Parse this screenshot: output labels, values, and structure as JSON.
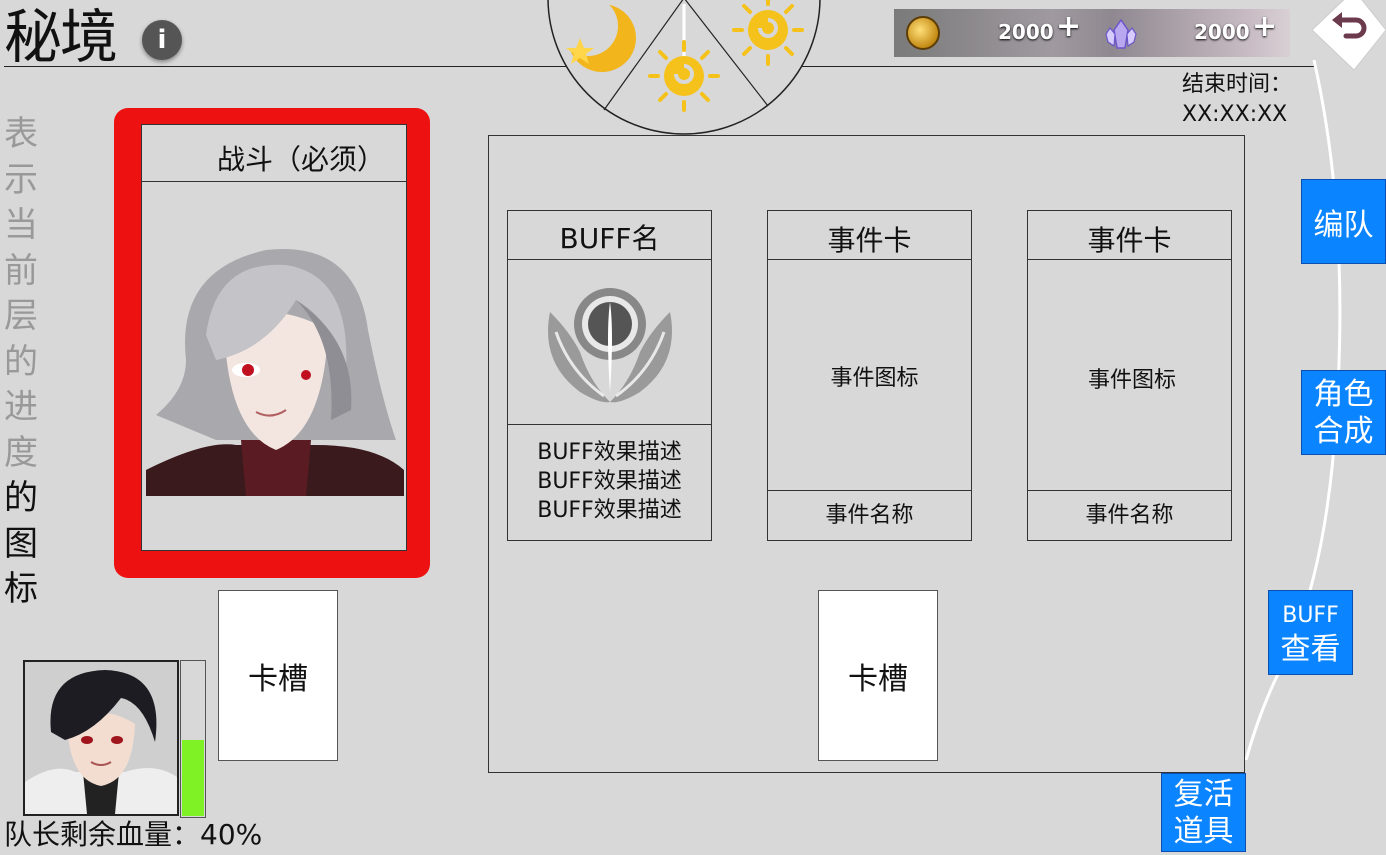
{
  "header": {
    "title": "秘境",
    "info_icon": "info-icon"
  },
  "currency": {
    "gold": {
      "icon": "gold-coin-icon",
      "value": "2000",
      "add_label": "+"
    },
    "crystal": {
      "icon": "crystal-icon",
      "value": "2000",
      "add_label": "+"
    }
  },
  "back_button": {
    "icon": "back-arrow-icon"
  },
  "end_time": {
    "label": "结束时间：",
    "value": "XX:XX:XX"
  },
  "progress_text": {
    "grey": [
      "表",
      "示",
      "当",
      "前",
      "层",
      "的",
      "进",
      "度"
    ],
    "dark": [
      "的",
      "图",
      "标"
    ]
  },
  "combat_card": {
    "title": "战斗（必须）"
  },
  "left_slot": {
    "label": "卡槽"
  },
  "leader": {
    "hp_text": "队长剩余血量：40%",
    "hp_fraction": 0.5
  },
  "buff_card": {
    "title": "BUFF名",
    "descriptions": [
      "BUFF效果描述",
      "BUFF效果描述",
      "BUFF效果描述"
    ]
  },
  "event_cards": [
    {
      "title": "事件卡",
      "icon_label": "事件图标",
      "name": "事件名称"
    },
    {
      "title": "事件卡",
      "icon_label": "事件图标",
      "name": "事件名称"
    }
  ],
  "center_slot": {
    "label": "卡槽"
  },
  "side_buttons": {
    "team": "编队",
    "compose_line1": "角色",
    "compose_line2": "合成",
    "buff_line1": "BUFF",
    "buff_line2": "查看",
    "revive_line1": "复活",
    "revive_line2": "道具"
  },
  "colors": {
    "accent_blue": "#0a84ff",
    "frame_red": "#ee1111",
    "hp_green": "#7ef224",
    "background": "#d8d8d8"
  }
}
